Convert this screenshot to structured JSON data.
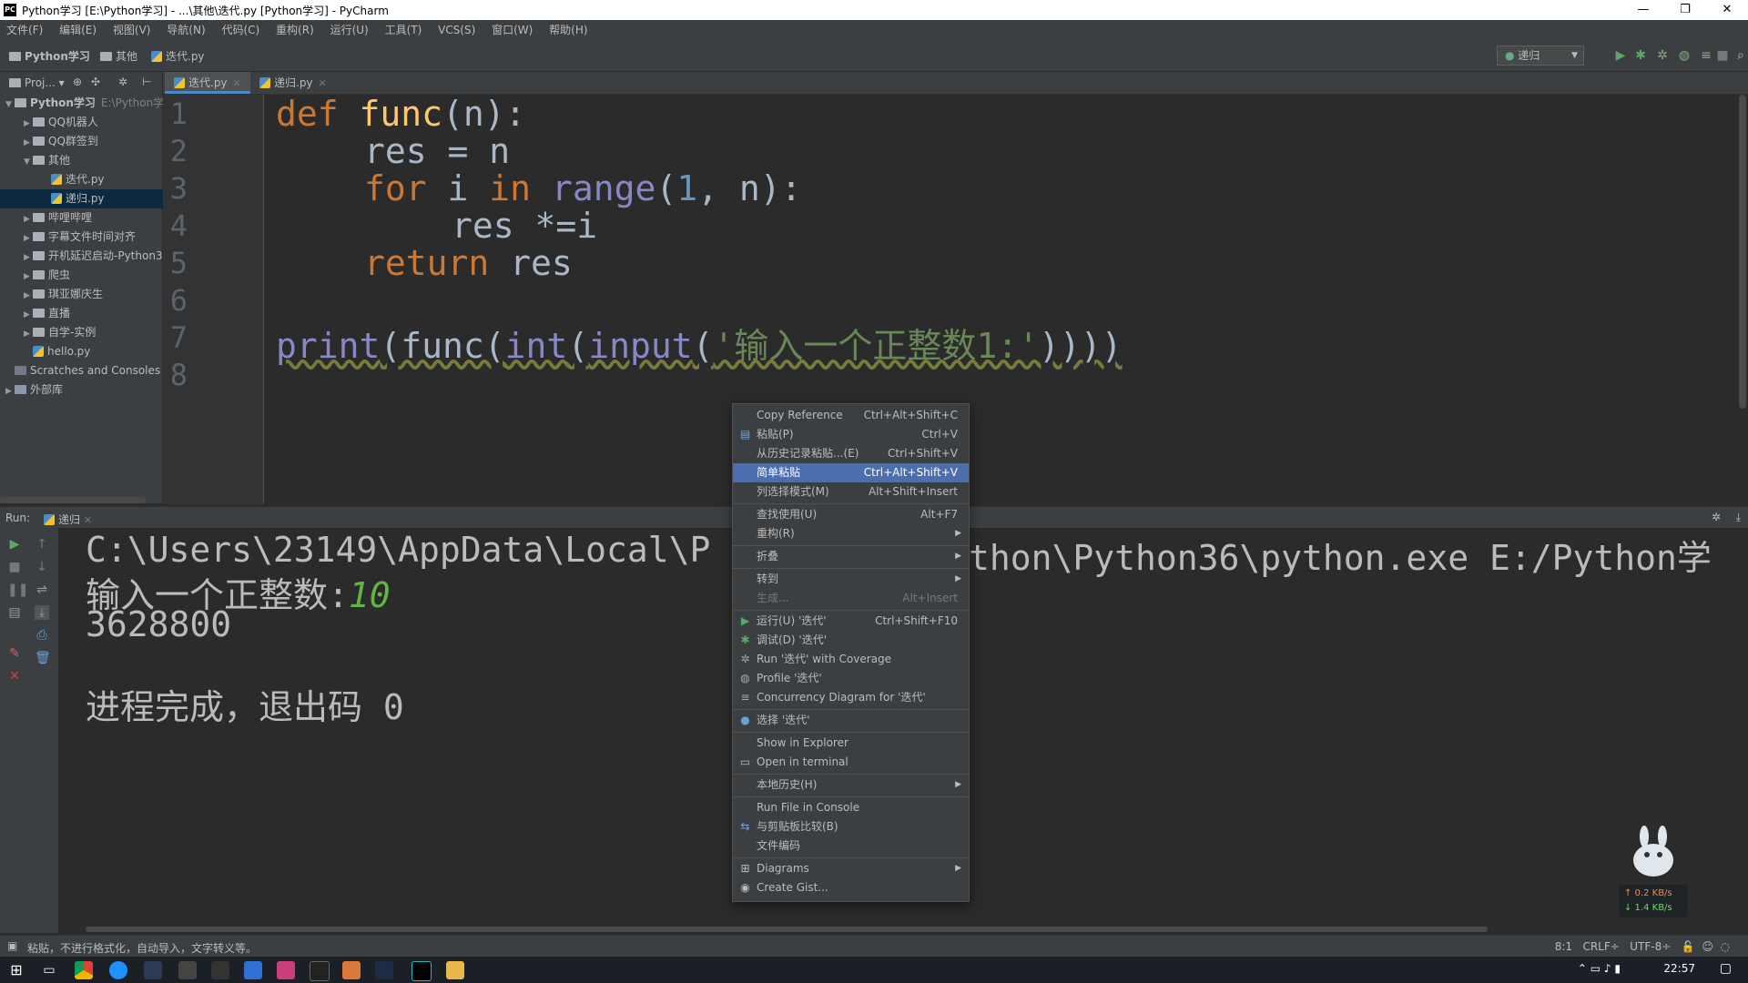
{
  "window": {
    "title": "Python学习 [E:\\Python学习] - ...\\其他\\迭代.py [Python学习] - PyCharm",
    "controls": [
      "—",
      "❐",
      "✕"
    ]
  },
  "menu": [
    "文件(F)",
    "编辑(E)",
    "视图(V)",
    "导航(N)",
    "代码(C)",
    "重构(R)",
    "运行(U)",
    "工具(T)",
    "VCS(S)",
    "窗口(W)",
    "帮助(H)"
  ],
  "breadcrumb": [
    "Python学习",
    "其他",
    "迭代.py"
  ],
  "run_config": "递归",
  "project_header": "Proj...",
  "tree": [
    {
      "label": "Python学习",
      "hint": "E:\\Python学",
      "level": 0,
      "arrow": "▼",
      "bold": true,
      "type": "folder"
    },
    {
      "label": "QQ机器人",
      "level": 1,
      "arrow": "▶",
      "type": "folder"
    },
    {
      "label": "QQ群签到",
      "level": 1,
      "arrow": "▶",
      "type": "folder"
    },
    {
      "label": "其他",
      "level": 1,
      "arrow": "▼",
      "type": "folder"
    },
    {
      "label": "迭代.py",
      "level": 2,
      "arrow": "",
      "type": "py"
    },
    {
      "label": "递归.py",
      "level": 2,
      "arrow": "",
      "type": "py",
      "selected": true
    },
    {
      "label": "哔哩哔哩",
      "level": 1,
      "arrow": "▶",
      "type": "folder"
    },
    {
      "label": "字幕文件时间对齐",
      "level": 1,
      "arrow": "▶",
      "type": "folder"
    },
    {
      "label": "开机延迟启动-Python3",
      "level": 1,
      "arrow": "▶",
      "type": "folder"
    },
    {
      "label": "爬虫",
      "level": 1,
      "arrow": "▶",
      "type": "folder"
    },
    {
      "label": "琪亚娜庆生",
      "level": 1,
      "arrow": "▶",
      "type": "folder"
    },
    {
      "label": "直播",
      "level": 1,
      "arrow": "▶",
      "type": "folder"
    },
    {
      "label": "自学-实例",
      "level": 1,
      "arrow": "▶",
      "type": "folder"
    },
    {
      "label": "hello.py",
      "level": 1,
      "arrow": "",
      "type": "py"
    },
    {
      "label": "Scratches and Consoles",
      "level": 0,
      "arrow": "",
      "type": "scratch"
    },
    {
      "label": "外部库",
      "level": 0,
      "arrow": "▶",
      "type": "lib"
    }
  ],
  "tabs": [
    {
      "label": "迭代.py",
      "active": true
    },
    {
      "label": "递归.py",
      "active": false
    }
  ],
  "line_numbers": [
    "1",
    "2",
    "3",
    "4",
    "5",
    "6",
    "7",
    "8"
  ],
  "code": {
    "l1": {
      "kw": "def",
      "fn": "func",
      "rest": "(n):"
    },
    "l2": {
      "text": "res = n"
    },
    "l3": {
      "kw1": "for",
      "mid": " i ",
      "kw2": "in",
      "bi": "range",
      "open": "(",
      "num": "1",
      "rest": ", n):"
    },
    "l4": {
      "text": "res *=i"
    },
    "l5": {
      "kw": "return",
      "rest": " res"
    },
    "l7": {
      "bi1": "print",
      "p1": "(func(",
      "bi2": "int",
      "p2": "(",
      "bi3": "input",
      "p3": "(",
      "str": "'输入一个正整数1:'",
      "p4": "))))"
    }
  },
  "run": {
    "label": "Run:",
    "tab": "递归",
    "lines": {
      "cmd": "C:\\Users\\23149\\AppData\\Local\\P",
      "cmd_tail": "thon\\Python36\\python.exe E:/Python学",
      "prompt": "输入一个正整数:",
      "input": "10",
      "result": "3628800",
      "exit": "进程完成，退出码 0"
    }
  },
  "context_menu": [
    {
      "label": "Copy Reference",
      "shortcut": "Ctrl+Alt+Shift+C",
      "icon": ""
    },
    {
      "label": "粘贴(P)",
      "shortcut": "Ctrl+V",
      "icon": "clipboard-icon"
    },
    {
      "label": "从历史记录粘贴...(E)",
      "shortcut": "Ctrl+Shift+V",
      "icon": ""
    },
    {
      "label": "简单粘贴",
      "shortcut": "Ctrl+Alt+Shift+V",
      "icon": "",
      "highlighted": true
    },
    {
      "label": "列选择模式(M)",
      "shortcut": "Alt+Shift+Insert",
      "icon": ""
    },
    {
      "sep": true
    },
    {
      "label": "查找使用(U)",
      "shortcut": "Alt+F7",
      "icon": ""
    },
    {
      "label": "重构(R)",
      "submenu": true,
      "icon": ""
    },
    {
      "sep": true
    },
    {
      "label": "折叠",
      "submenu": true,
      "icon": ""
    },
    {
      "sep": true
    },
    {
      "label": "转到",
      "submenu": true,
      "icon": ""
    },
    {
      "label": "生成...",
      "shortcut": "Alt+Insert",
      "icon": "",
      "disabled": true
    },
    {
      "sep": true
    },
    {
      "label": "运行(U) '迭代'",
      "shortcut": "Ctrl+Shift+F10",
      "icon": "run-icon"
    },
    {
      "label": "调试(D) '迭代'",
      "icon": "debug-icon"
    },
    {
      "label": "Run '迭代' with Coverage",
      "icon": "coverage-icon"
    },
    {
      "label": "Profile '迭代'",
      "icon": "profile-icon"
    },
    {
      "label": "Concurrency Diagram for '迭代'",
      "icon": "concurrency-icon"
    },
    {
      "sep": true
    },
    {
      "label": "选择 '迭代'",
      "icon": "python-icon"
    },
    {
      "sep": true
    },
    {
      "label": "Show in Explorer",
      "icon": ""
    },
    {
      "label": "Open in terminal",
      "icon": "terminal-icon"
    },
    {
      "sep": true
    },
    {
      "label": "本地历史(H)",
      "submenu": true,
      "icon": ""
    },
    {
      "sep": true
    },
    {
      "label": "Run File in Console",
      "icon": ""
    },
    {
      "label": "与剪贴板比较(B)",
      "icon": "compare-icon"
    },
    {
      "label": "文件编码",
      "icon": ""
    },
    {
      "sep": true
    },
    {
      "label": "Diagrams",
      "submenu": true,
      "icon": "diagram-icon"
    },
    {
      "label": "Create Gist...",
      "icon": "github-icon"
    }
  ],
  "status": {
    "message": "粘贴，不进行格式化，自动导入，文字转义等。",
    "position": "8:1",
    "line_sep": "CRLF÷",
    "encoding": "UTF-8÷"
  },
  "net_widget": {
    "up": "↑ 0.2 KB/s",
    "down": "↓ 1.4 KB/s"
  },
  "clock": "22:57",
  "colors": {
    "accent": "#4b6eaf",
    "keyword": "#cc7832",
    "function": "#ffc66d",
    "builtin": "#8888c6",
    "number": "#6897bb",
    "string": "#6a8759"
  }
}
